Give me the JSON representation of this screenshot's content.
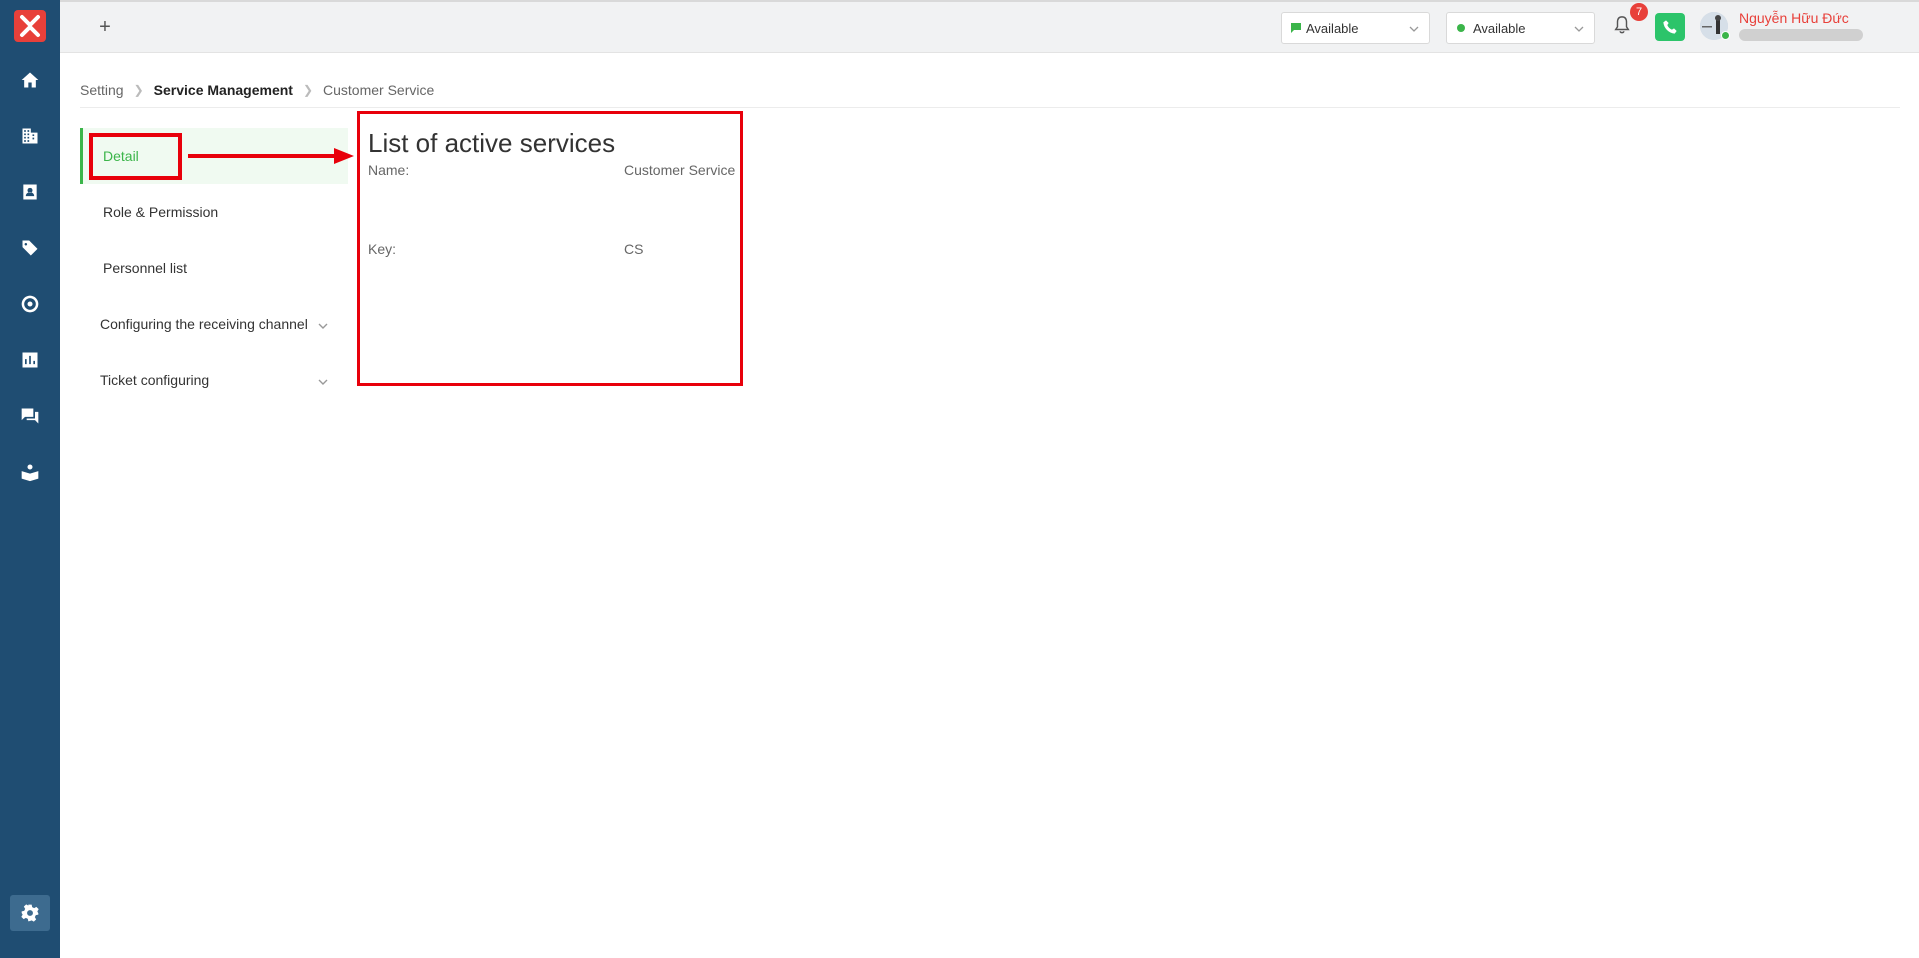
{
  "topbar": {
    "add_tab_label": "+",
    "status_chat": "Available",
    "status_call": "Available",
    "notification_count": "7",
    "user_name": "Nguyễn Hữu Đức"
  },
  "breadcrumb": {
    "items": [
      "Setting",
      "Service Management",
      "Customer Service"
    ]
  },
  "menu": {
    "items": [
      {
        "label": "Detail"
      },
      {
        "label": "Role & Permission"
      },
      {
        "label": "Personnel list"
      },
      {
        "label": "Configuring the receiving channel"
      },
      {
        "label": "Ticket configuring"
      }
    ]
  },
  "detail": {
    "title": "List of active services",
    "name_label": "Name:",
    "name_value": "Customer Service",
    "key_label": "Key:",
    "key_value": "CS"
  },
  "colors": {
    "sidebar": "#1f4d72",
    "accent_green": "#3bb54a",
    "brand_red": "#e8403a",
    "annotation_red": "#e8000b"
  }
}
